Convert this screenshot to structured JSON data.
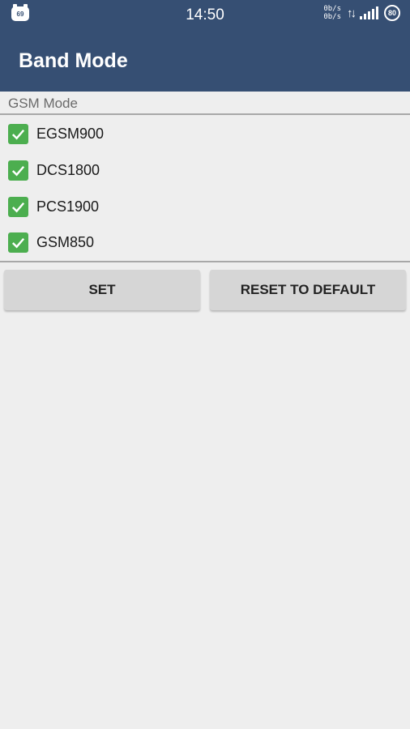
{
  "status_bar": {
    "notification_badge": "69",
    "time": "14:50",
    "net_speed_up": "0b/s",
    "net_speed_down": "0b/s",
    "battery": "80"
  },
  "toolbar": {
    "title": "Band Mode"
  },
  "section": {
    "header": "GSM Mode"
  },
  "bands": [
    {
      "label": "EGSM900",
      "checked": true
    },
    {
      "label": "DCS1800",
      "checked": true
    },
    {
      "label": "PCS1900",
      "checked": true
    },
    {
      "label": "GSM850",
      "checked": true
    }
  ],
  "buttons": {
    "set": "SET",
    "reset": "RESET TO DEFAULT"
  },
  "colors": {
    "primary": "#364f73",
    "checkbox": "#4cae4f",
    "background": "#eeeeee"
  }
}
